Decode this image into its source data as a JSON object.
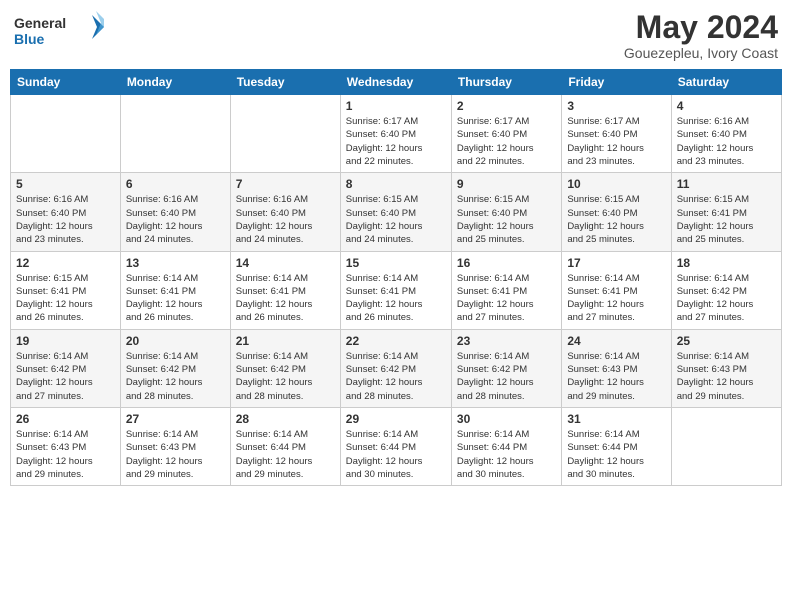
{
  "logo": {
    "line1": "General",
    "line2": "Blue"
  },
  "header": {
    "month_year": "May 2024",
    "location": "Gouezepleu, Ivory Coast"
  },
  "days_of_week": [
    "Sunday",
    "Monday",
    "Tuesday",
    "Wednesday",
    "Thursday",
    "Friday",
    "Saturday"
  ],
  "weeks": [
    [
      {
        "day": "",
        "info": ""
      },
      {
        "day": "",
        "info": ""
      },
      {
        "day": "",
        "info": ""
      },
      {
        "day": "1",
        "info": "Sunrise: 6:17 AM\nSunset: 6:40 PM\nDaylight: 12 hours\nand 22 minutes."
      },
      {
        "day": "2",
        "info": "Sunrise: 6:17 AM\nSunset: 6:40 PM\nDaylight: 12 hours\nand 22 minutes."
      },
      {
        "day": "3",
        "info": "Sunrise: 6:17 AM\nSunset: 6:40 PM\nDaylight: 12 hours\nand 23 minutes."
      },
      {
        "day": "4",
        "info": "Sunrise: 6:16 AM\nSunset: 6:40 PM\nDaylight: 12 hours\nand 23 minutes."
      }
    ],
    [
      {
        "day": "5",
        "info": "Sunrise: 6:16 AM\nSunset: 6:40 PM\nDaylight: 12 hours\nand 23 minutes."
      },
      {
        "day": "6",
        "info": "Sunrise: 6:16 AM\nSunset: 6:40 PM\nDaylight: 12 hours\nand 24 minutes."
      },
      {
        "day": "7",
        "info": "Sunrise: 6:16 AM\nSunset: 6:40 PM\nDaylight: 12 hours\nand 24 minutes."
      },
      {
        "day": "8",
        "info": "Sunrise: 6:15 AM\nSunset: 6:40 PM\nDaylight: 12 hours\nand 24 minutes."
      },
      {
        "day": "9",
        "info": "Sunrise: 6:15 AM\nSunset: 6:40 PM\nDaylight: 12 hours\nand 25 minutes."
      },
      {
        "day": "10",
        "info": "Sunrise: 6:15 AM\nSunset: 6:40 PM\nDaylight: 12 hours\nand 25 minutes."
      },
      {
        "day": "11",
        "info": "Sunrise: 6:15 AM\nSunset: 6:41 PM\nDaylight: 12 hours\nand 25 minutes."
      }
    ],
    [
      {
        "day": "12",
        "info": "Sunrise: 6:15 AM\nSunset: 6:41 PM\nDaylight: 12 hours\nand 26 minutes."
      },
      {
        "day": "13",
        "info": "Sunrise: 6:14 AM\nSunset: 6:41 PM\nDaylight: 12 hours\nand 26 minutes."
      },
      {
        "day": "14",
        "info": "Sunrise: 6:14 AM\nSunset: 6:41 PM\nDaylight: 12 hours\nand 26 minutes."
      },
      {
        "day": "15",
        "info": "Sunrise: 6:14 AM\nSunset: 6:41 PM\nDaylight: 12 hours\nand 26 minutes."
      },
      {
        "day": "16",
        "info": "Sunrise: 6:14 AM\nSunset: 6:41 PM\nDaylight: 12 hours\nand 27 minutes."
      },
      {
        "day": "17",
        "info": "Sunrise: 6:14 AM\nSunset: 6:41 PM\nDaylight: 12 hours\nand 27 minutes."
      },
      {
        "day": "18",
        "info": "Sunrise: 6:14 AM\nSunset: 6:42 PM\nDaylight: 12 hours\nand 27 minutes."
      }
    ],
    [
      {
        "day": "19",
        "info": "Sunrise: 6:14 AM\nSunset: 6:42 PM\nDaylight: 12 hours\nand 27 minutes."
      },
      {
        "day": "20",
        "info": "Sunrise: 6:14 AM\nSunset: 6:42 PM\nDaylight: 12 hours\nand 28 minutes."
      },
      {
        "day": "21",
        "info": "Sunrise: 6:14 AM\nSunset: 6:42 PM\nDaylight: 12 hours\nand 28 minutes."
      },
      {
        "day": "22",
        "info": "Sunrise: 6:14 AM\nSunset: 6:42 PM\nDaylight: 12 hours\nand 28 minutes."
      },
      {
        "day": "23",
        "info": "Sunrise: 6:14 AM\nSunset: 6:42 PM\nDaylight: 12 hours\nand 28 minutes."
      },
      {
        "day": "24",
        "info": "Sunrise: 6:14 AM\nSunset: 6:43 PM\nDaylight: 12 hours\nand 29 minutes."
      },
      {
        "day": "25",
        "info": "Sunrise: 6:14 AM\nSunset: 6:43 PM\nDaylight: 12 hours\nand 29 minutes."
      }
    ],
    [
      {
        "day": "26",
        "info": "Sunrise: 6:14 AM\nSunset: 6:43 PM\nDaylight: 12 hours\nand 29 minutes."
      },
      {
        "day": "27",
        "info": "Sunrise: 6:14 AM\nSunset: 6:43 PM\nDaylight: 12 hours\nand 29 minutes."
      },
      {
        "day": "28",
        "info": "Sunrise: 6:14 AM\nSunset: 6:44 PM\nDaylight: 12 hours\nand 29 minutes."
      },
      {
        "day": "29",
        "info": "Sunrise: 6:14 AM\nSunset: 6:44 PM\nDaylight: 12 hours\nand 30 minutes."
      },
      {
        "day": "30",
        "info": "Sunrise: 6:14 AM\nSunset: 6:44 PM\nDaylight: 12 hours\nand 30 minutes."
      },
      {
        "day": "31",
        "info": "Sunrise: 6:14 AM\nSunset: 6:44 PM\nDaylight: 12 hours\nand 30 minutes."
      },
      {
        "day": "",
        "info": ""
      }
    ]
  ]
}
